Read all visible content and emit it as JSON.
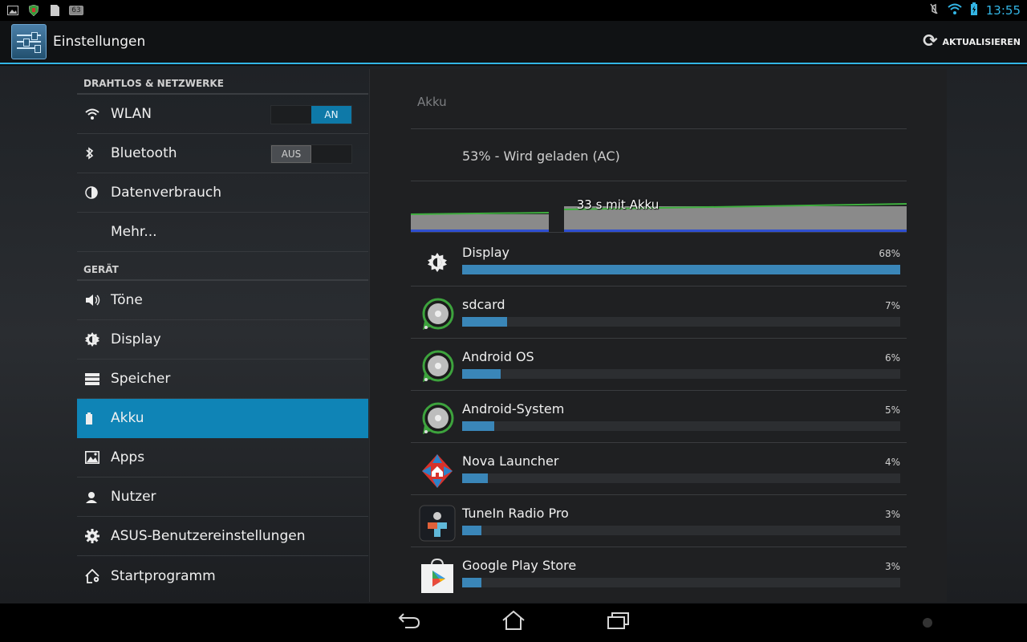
{
  "status_bar": {
    "time": "13:55",
    "notification_badge": "63"
  },
  "action_bar": {
    "title": "Einstellungen",
    "refresh_label": "AKTUALISIEREN"
  },
  "sidebar": {
    "sections": [
      {
        "header": "DRAHTLOS & NETZWERKE",
        "items": [
          {
            "label": "WLAN",
            "icon": "wifi-icon",
            "toggle": "AN"
          },
          {
            "label": "Bluetooth",
            "icon": "bluetooth-icon",
            "toggle": "AUS"
          },
          {
            "label": "Datenverbrauch",
            "icon": "data-usage-icon"
          },
          {
            "label": "Mehr...",
            "icon": ""
          }
        ]
      },
      {
        "header": "GERÄT",
        "items": [
          {
            "label": "Töne",
            "icon": "sound-icon"
          },
          {
            "label": "Display",
            "icon": "brightness-icon"
          },
          {
            "label": "Speicher",
            "icon": "storage-icon"
          },
          {
            "label": "Akku",
            "icon": "battery-icon",
            "selected": true
          },
          {
            "label": "Apps",
            "icon": "apps-icon"
          },
          {
            "label": "Nutzer",
            "icon": "user-icon"
          },
          {
            "label": "ASUS-Benutzereinstellungen",
            "icon": "gear-icon"
          },
          {
            "label": "Startprogramm",
            "icon": "home-gear-icon"
          }
        ]
      }
    ]
  },
  "battery": {
    "title": "Akku",
    "status": "53% - Wird geladen (AC)",
    "graph_label": "33 s mit Akku",
    "usage": [
      {
        "name": "Display",
        "percent": "68%",
        "value": 68,
        "icon": "brightness-icon"
      },
      {
        "name": "sdcard",
        "percent": "7%",
        "value": 7,
        "icon": "android-disc-icon"
      },
      {
        "name": "Android OS",
        "percent": "6%",
        "value": 6,
        "icon": "android-disc-icon"
      },
      {
        "name": "Android-System",
        "percent": "5%",
        "value": 5,
        "icon": "android-disc-icon"
      },
      {
        "name": "Nova Launcher",
        "percent": "4%",
        "value": 4,
        "icon": "nova-launcher-icon"
      },
      {
        "name": "TuneIn Radio Pro",
        "percent": "3%",
        "value": 3,
        "icon": "tunein-icon"
      },
      {
        "name": "Google Play Store",
        "percent": "3%",
        "value": 3,
        "icon": "play-store-icon"
      }
    ]
  },
  "colors": {
    "accent": "#33b5e5",
    "selected": "#0f84b6",
    "bar": "#3a86b8"
  }
}
